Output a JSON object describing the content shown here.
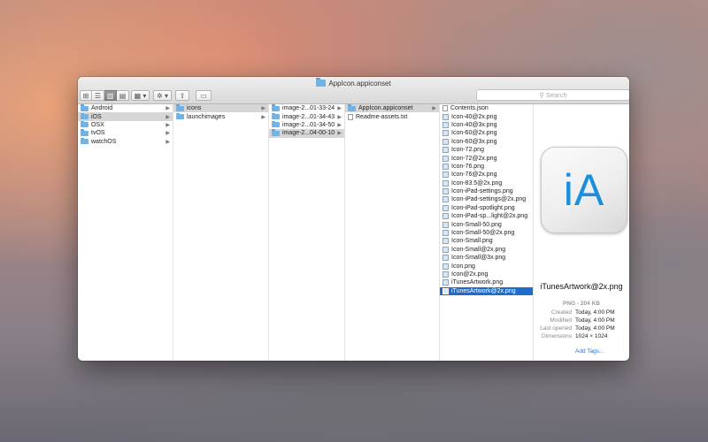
{
  "window": {
    "title": "AppIcon.appiconset"
  },
  "toolbar": {
    "search_placeholder": "Search",
    "view_icon": "⊞",
    "view_list": "☰",
    "view_columns": "▥",
    "view_coverflow": "▤",
    "arrange": "▦ ▾",
    "action": "✲ ▾",
    "share": "⇪",
    "tag": "▭"
  },
  "columns": [
    {
      "items": [
        {
          "label": "Android",
          "type": "folder",
          "state": ""
        },
        {
          "label": "iOS",
          "type": "folder",
          "state": "selg"
        },
        {
          "label": "OSX",
          "type": "folder",
          "state": ""
        },
        {
          "label": "tvOS",
          "type": "folder",
          "state": ""
        },
        {
          "label": "watchOS",
          "type": "folder",
          "state": ""
        }
      ]
    },
    {
      "items": [
        {
          "label": "icons",
          "type": "folder",
          "state": "selg"
        },
        {
          "label": "launchimages",
          "type": "folder",
          "state": ""
        }
      ]
    },
    {
      "items": [
        {
          "label": "image-2...01-33-24",
          "type": "folder",
          "state": ""
        },
        {
          "label": "image-2...01-34-43",
          "type": "folder",
          "state": ""
        },
        {
          "label": "image-2...01-34-50",
          "type": "folder",
          "state": ""
        },
        {
          "label": "image-2...04-00-10",
          "type": "folder",
          "state": "selg"
        }
      ]
    },
    {
      "items": [
        {
          "label": "AppIcon.appiconset",
          "type": "folder",
          "state": "selg"
        },
        {
          "label": "Readme-assets.txt",
          "type": "doc",
          "state": ""
        }
      ]
    },
    {
      "items": [
        {
          "label": "Contents.json",
          "type": "doc",
          "state": ""
        },
        {
          "label": "Icon-40@2x.png",
          "type": "png",
          "state": ""
        },
        {
          "label": "Icon-40@3x.png",
          "type": "png",
          "state": ""
        },
        {
          "label": "Icon-60@2x.png",
          "type": "png",
          "state": ""
        },
        {
          "label": "Icon-60@3x.png",
          "type": "png",
          "state": ""
        },
        {
          "label": "Icon-72.png",
          "type": "png",
          "state": ""
        },
        {
          "label": "Icon-72@2x.png",
          "type": "png",
          "state": ""
        },
        {
          "label": "Icon-76.png",
          "type": "png",
          "state": ""
        },
        {
          "label": "Icon-76@2x.png",
          "type": "png",
          "state": ""
        },
        {
          "label": "Icon-83.5@2x.png",
          "type": "png",
          "state": ""
        },
        {
          "label": "Icon-iPad-settings.png",
          "type": "png",
          "state": ""
        },
        {
          "label": "Icon-iPad-settings@2x.png",
          "type": "png",
          "state": ""
        },
        {
          "label": "Icon-iPad-spotlight.png",
          "type": "png",
          "state": ""
        },
        {
          "label": "Icon-iPad-sp...light@2x.png",
          "type": "png",
          "state": ""
        },
        {
          "label": "Icon-Small-50.png",
          "type": "png",
          "state": ""
        },
        {
          "label": "Icon-Small-50@2x.png",
          "type": "png",
          "state": ""
        },
        {
          "label": "Icon-Small.png",
          "type": "png",
          "state": ""
        },
        {
          "label": "Icon-Small@2x.png",
          "type": "png",
          "state": ""
        },
        {
          "label": "Icon-Small@3x.png",
          "type": "png",
          "state": ""
        },
        {
          "label": "Icon.png",
          "type": "png",
          "state": ""
        },
        {
          "label": "Icon@2x.png",
          "type": "png",
          "state": ""
        },
        {
          "label": "iTunesArtwork.png",
          "type": "png",
          "state": ""
        },
        {
          "label": "iTunesArtwork@2x.png",
          "type": "png",
          "state": "selb"
        }
      ]
    }
  ],
  "preview": {
    "icon_text": "iA",
    "filename": "iTunesArtwork@2x.png",
    "kind": "PNG - 204 KB",
    "meta": [
      {
        "key": "Created",
        "value": "Today, 4:00 PM"
      },
      {
        "key": "Modified",
        "value": "Today, 4:00 PM"
      },
      {
        "key": "Last opened",
        "value": "Today, 4:00 PM"
      },
      {
        "key": "Dimensions",
        "value": "1024 × 1024"
      }
    ],
    "add_tags": "Add Tags..."
  }
}
